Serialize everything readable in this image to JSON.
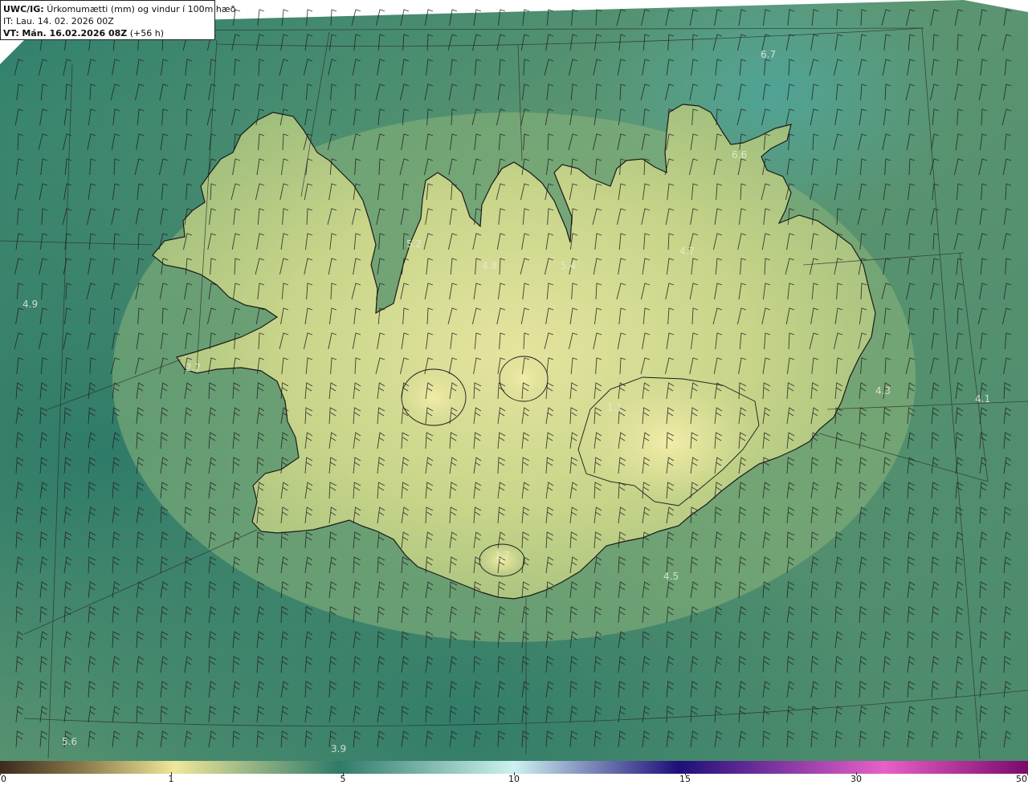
{
  "header": {
    "model_code": "UWC/IG:",
    "title": "Úrkomumætti (mm) og vindur í 100m hæð",
    "it_line": "IT: Lau. 14. 02. 2026 00Z",
    "vt_prefix": "VT:",
    "vt_bold": "Mán. 16.02.2026 08Z",
    "vt_suffix": "(+56 h)"
  },
  "map_labels": [
    {
      "text": "6.7"
    },
    {
      "text": "6.6"
    },
    {
      "text": "5.2"
    },
    {
      "text": "4.8"
    },
    {
      "text": "5.4"
    },
    {
      "text": "4.7"
    },
    {
      "text": "4.9"
    },
    {
      "text": "4.3"
    },
    {
      "text": "4.1"
    },
    {
      "text": "4.5"
    },
    {
      "text": "5.6"
    },
    {
      "text": "3.9"
    },
    {
      "text": "2.7"
    },
    {
      "text": "1.1"
    },
    {
      "text": "1.7"
    }
  ],
  "colorbar": {
    "ticks": [
      "0",
      "1",
      "5",
      "10",
      "15",
      "30",
      "50"
    ],
    "colors": [
      "#3b2a1f",
      "#8a7a4a",
      "#efe79a",
      "#2f7a6a",
      "#cdf2f0",
      "#1e0f7a",
      "#e860c8",
      "#7a0a6a"
    ]
  },
  "colors": {
    "land_light": "#d8dc90",
    "sea_mid": "#5f9670",
    "sea_dark": "#2f7a6a",
    "coast": "#1a1a1a"
  }
}
